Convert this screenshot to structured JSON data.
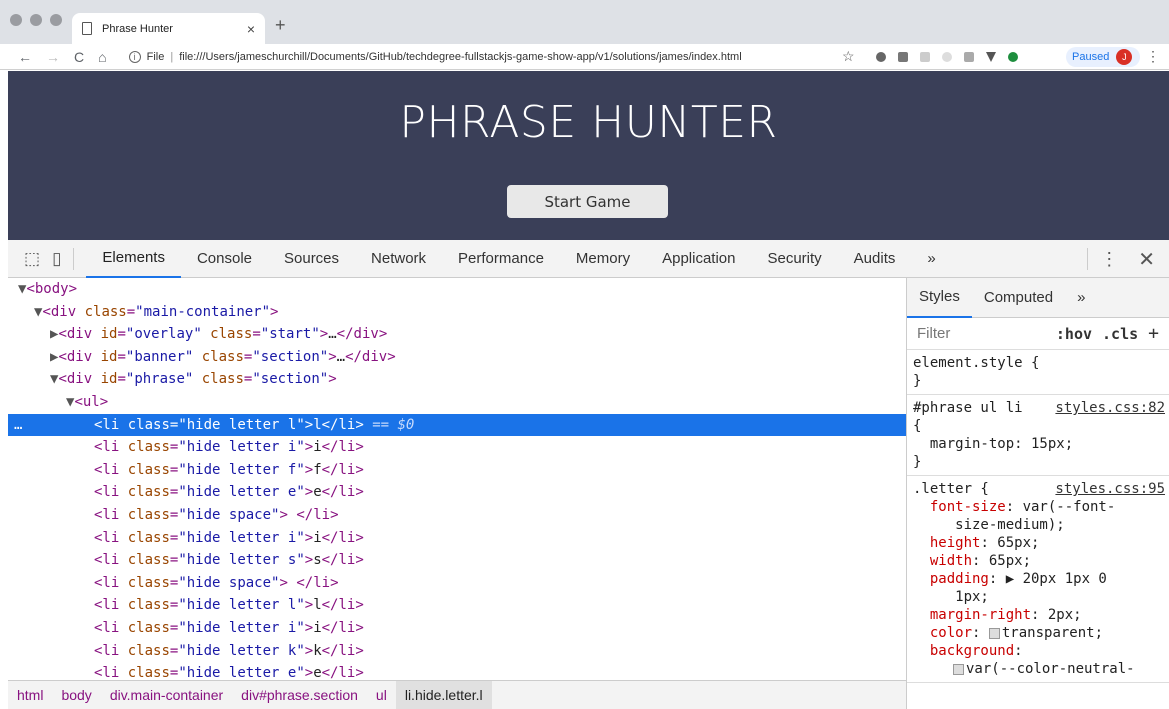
{
  "browser": {
    "tab_title": "Phrase Hunter",
    "new_tab": "+",
    "close": "×",
    "file_label": "File",
    "separator": "|",
    "url": "file:///Users/jameschurchill/Documents/GitHub/techdegree-fullstackjs-game-show-app/v1/solutions/james/index.html",
    "paused_label": "Paused",
    "profile_initial": "J"
  },
  "page": {
    "title": "PHRASE HUNTER",
    "start_button": "Start Game"
  },
  "devtools": {
    "tabs": [
      "Elements",
      "Console",
      "Sources",
      "Network",
      "Performance",
      "Memory",
      "Application",
      "Security",
      "Audits"
    ],
    "more": "»",
    "elements_lines": [
      {
        "indent": 0,
        "arrow": "▼",
        "html": "<body>"
      },
      {
        "indent": 1,
        "arrow": "▼",
        "html": "<div class=\"main-container\">"
      },
      {
        "indent": 2,
        "arrow": "▶",
        "html": "<div id=\"overlay\" class=\"start\">…</div>"
      },
      {
        "indent": 2,
        "arrow": "▶",
        "html": "<div id=\"banner\" class=\"section\">…</div>"
      },
      {
        "indent": 2,
        "arrow": "▼",
        "html": "<div id=\"phrase\" class=\"section\">"
      },
      {
        "indent": 3,
        "arrow": "▼",
        "html": "<ul>"
      },
      {
        "indent": 4,
        "arrow": "",
        "html": "<li class=\"hide letter l\">l</li>",
        "selected": true,
        "suffix": "== $0"
      },
      {
        "indent": 4,
        "arrow": "",
        "html": "<li class=\"hide letter i\">i</li>"
      },
      {
        "indent": 4,
        "arrow": "",
        "html": "<li class=\"hide letter f\">f</li>"
      },
      {
        "indent": 4,
        "arrow": "",
        "html": "<li class=\"hide letter e\">e</li>"
      },
      {
        "indent": 4,
        "arrow": "",
        "html": "<li class=\"hide space\"> </li>"
      },
      {
        "indent": 4,
        "arrow": "",
        "html": "<li class=\"hide letter i\">i</li>"
      },
      {
        "indent": 4,
        "arrow": "",
        "html": "<li class=\"hide letter s\">s</li>"
      },
      {
        "indent": 4,
        "arrow": "",
        "html": "<li class=\"hide space\"> </li>"
      },
      {
        "indent": 4,
        "arrow": "",
        "html": "<li class=\"hide letter l\">l</li>"
      },
      {
        "indent": 4,
        "arrow": "",
        "html": "<li class=\"hide letter i\">i</li>"
      },
      {
        "indent": 4,
        "arrow": "",
        "html": "<li class=\"hide letter k\">k</li>"
      },
      {
        "indent": 4,
        "arrow": "",
        "html": "<li class=\"hide letter e\">e</li>"
      }
    ],
    "breadcrumbs": [
      "html",
      "body",
      "div.main-container",
      "div#phrase.section",
      "ul",
      "li.hide.letter.l"
    ],
    "styles_tabs": [
      "Styles",
      "Computed",
      "»"
    ],
    "filter_placeholder": "Filter",
    "hov": ":hov",
    "cls": ".cls",
    "plus": "+",
    "rules": {
      "element_style": "element.style {\n}",
      "phrase_selector": "#phrase ul li",
      "phrase_src": "styles.css:82",
      "phrase_body": "{\n  margin-top: 15px;\n}",
      "letter_selector": ".letter {",
      "letter_src": "styles.css:95",
      "letter_props": [
        [
          "font-size",
          "var(--font-\n     size-medium);"
        ],
        [
          "height",
          "65px;"
        ],
        [
          "width",
          "65px;"
        ],
        [
          "padding",
          "▶ 20px 1px 0\n     1px;"
        ],
        [
          "margin-right",
          "2px;"
        ],
        [
          "color",
          "transparent;"
        ],
        [
          "background",
          ""
        ]
      ],
      "background_value": "var(--color-neutral-"
    }
  }
}
